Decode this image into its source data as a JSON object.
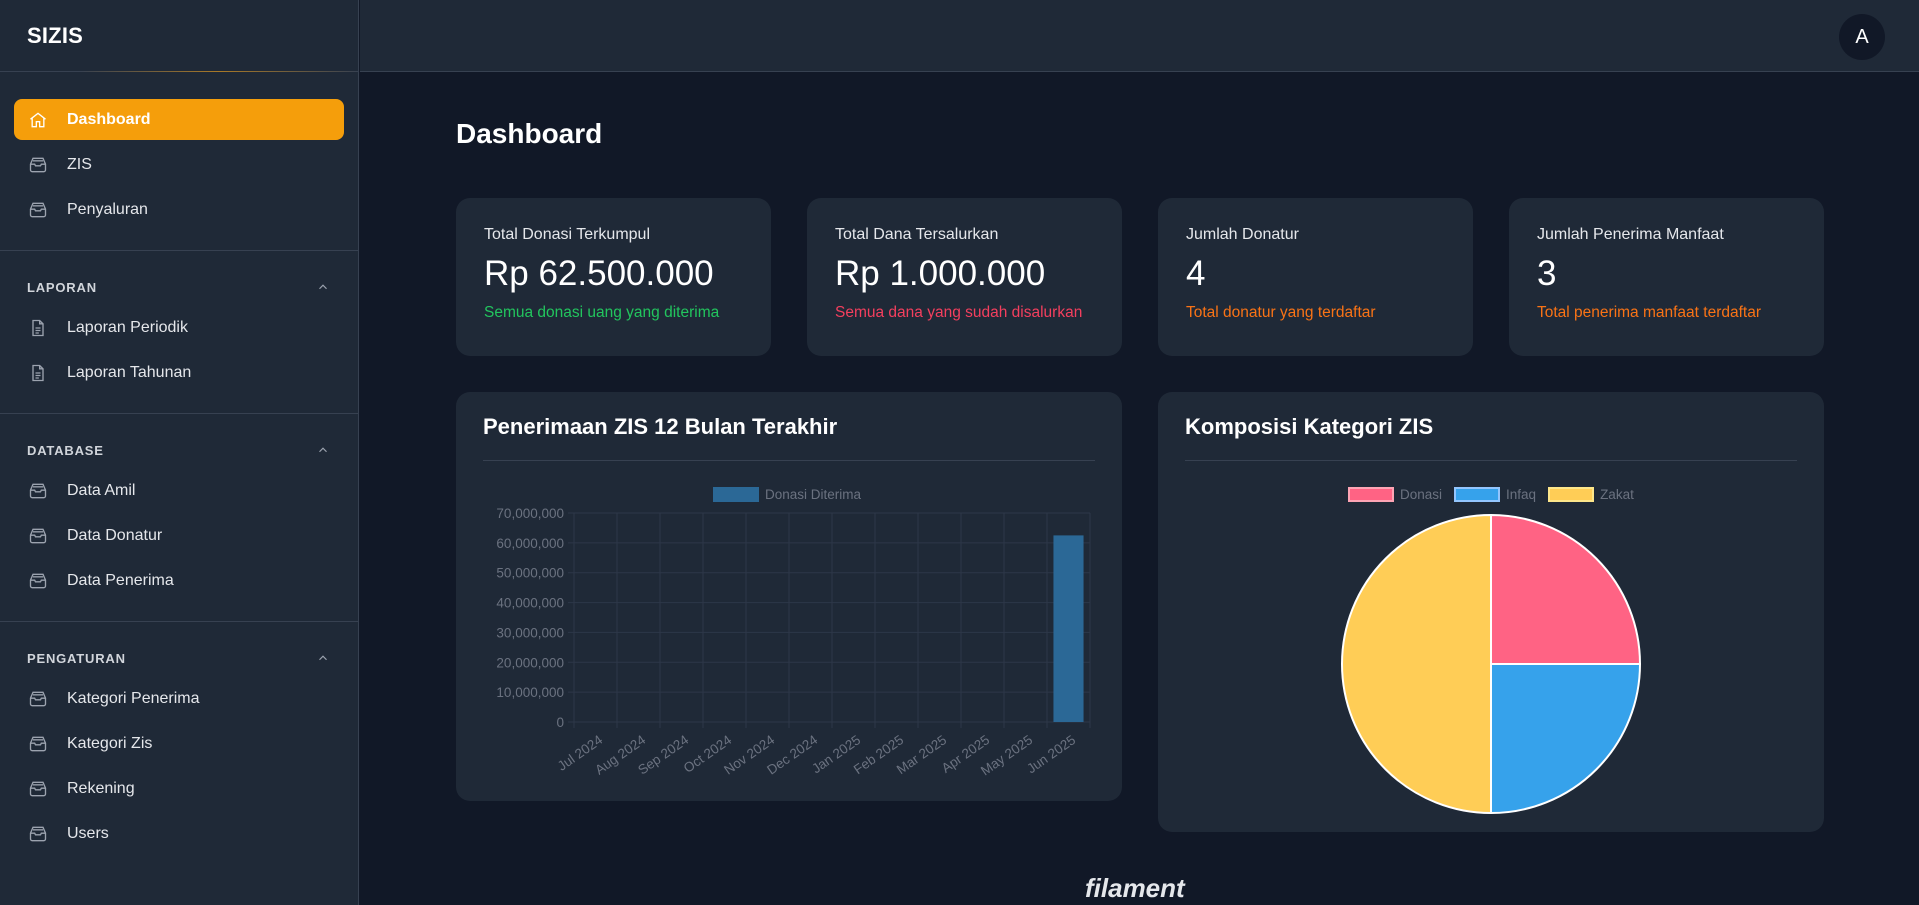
{
  "brand": "SIZIS",
  "avatar_initial": "A",
  "nav": {
    "main": [
      {
        "label": "Dashboard",
        "icon": "home-icon",
        "active": true
      },
      {
        "label": "ZIS",
        "icon": "inbox-stack-icon"
      },
      {
        "label": "Penyaluran",
        "icon": "inbox-stack-icon"
      }
    ],
    "groups": [
      {
        "label": "LAPORAN",
        "items": [
          {
            "label": "Laporan Periodik",
            "icon": "document-text-icon"
          },
          {
            "label": "Laporan Tahunan",
            "icon": "document-text-icon"
          }
        ]
      },
      {
        "label": "DATABASE",
        "items": [
          {
            "label": "Data Amil",
            "icon": "inbox-stack-icon"
          },
          {
            "label": "Data Donatur",
            "icon": "inbox-stack-icon"
          },
          {
            "label": "Data Penerima",
            "icon": "inbox-stack-icon"
          }
        ]
      },
      {
        "label": "PENGATURAN",
        "items": [
          {
            "label": "Kategori Penerima",
            "icon": "inbox-stack-icon"
          },
          {
            "label": "Kategori Zis",
            "icon": "inbox-stack-icon"
          },
          {
            "label": "Rekening",
            "icon": "inbox-stack-icon"
          },
          {
            "label": "Users",
            "icon": "inbox-stack-icon"
          }
        ]
      }
    ]
  },
  "page": {
    "title": "Dashboard"
  },
  "stats": [
    {
      "label": "Total Donasi Terkumpul",
      "value": "Rp 62.500.000",
      "desc": "Semua donasi uang yang diterima",
      "color": "#22c55e"
    },
    {
      "label": "Total Dana Tersalurkan",
      "value": "Rp 1.000.000",
      "desc": "Semua dana yang sudah disalurkan",
      "color": "#f43f5e"
    },
    {
      "label": "Jumlah Donatur",
      "value": "4",
      "desc": "Total donatur yang terdaftar",
      "color": "#f97316"
    },
    {
      "label": "Jumlah Penerima Manfaat",
      "value": "3",
      "desc": "Total penerima manfaat terdaftar",
      "color": "#f97316"
    }
  ],
  "bar_card": {
    "title": "Penerimaan ZIS 12 Bulan Terakhir"
  },
  "pie_card": {
    "title": "Komposisi Kategori ZIS"
  },
  "footer_logo": "filament",
  "colors": {
    "accent": "#f59e0b",
    "bar": "#2b6896",
    "donasi": "#ff6384",
    "infaq": "#36a2eb",
    "zakat": "#ffcd56"
  },
  "chart_data": [
    {
      "type": "bar",
      "title": "Penerimaan ZIS 12 Bulan Terakhir",
      "categories": [
        "Jul 2024",
        "Aug 2024",
        "Sep 2024",
        "Oct 2024",
        "Nov 2024",
        "Dec 2024",
        "Jan 2025",
        "Feb 2025",
        "Mar 2025",
        "Apr 2025",
        "May 2025",
        "Jun 2025"
      ],
      "series": [
        {
          "name": "Donasi Diterima",
          "values": [
            0,
            0,
            0,
            0,
            0,
            0,
            0,
            0,
            0,
            0,
            0,
            62500000
          ]
        }
      ],
      "ylim": [
        0,
        70000000
      ],
      "yticks": [
        "70,000,000",
        "60,000,000",
        "50,000,000",
        "40,000,000",
        "30,000,000",
        "20,000,000",
        "10,000,000",
        "0"
      ],
      "ytick_values": [
        70000000,
        60000000,
        50000000,
        40000000,
        30000000,
        20000000,
        10000000,
        0
      ],
      "grid": true,
      "legend": "top"
    },
    {
      "type": "pie",
      "title": "Komposisi Kategori ZIS",
      "labels": [
        "Donasi",
        "Infaq",
        "Zakat"
      ],
      "values": [
        25,
        25,
        50
      ],
      "colors": [
        "#ff6384",
        "#36a2eb",
        "#ffcd56"
      ],
      "legend": "top"
    }
  ]
}
